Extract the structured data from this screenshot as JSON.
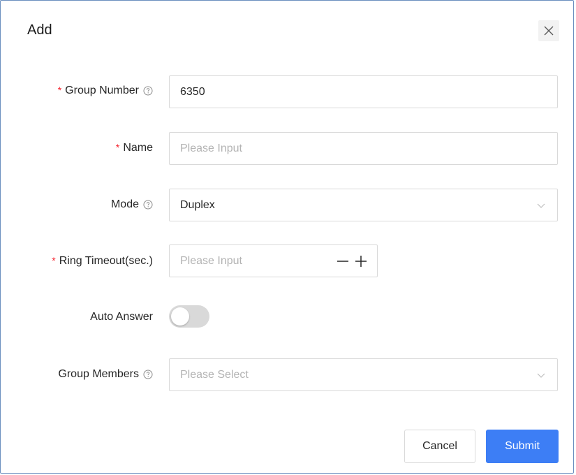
{
  "dialog": {
    "title": "Add",
    "close_icon": "close-icon"
  },
  "form": {
    "group_number": {
      "label": "Group Number",
      "required": true,
      "value": "6350",
      "help_icon": "question-circle-icon"
    },
    "name": {
      "label": "Name",
      "required": true,
      "placeholder": "Please Input"
    },
    "mode": {
      "label": "Mode",
      "selected": "Duplex",
      "help_icon": "question-circle-icon"
    },
    "ring_timeout": {
      "label": "Ring Timeout(sec.)",
      "required": true,
      "placeholder": "Please Input",
      "minus_icon": "minus-icon",
      "plus_icon": "plus-icon"
    },
    "auto_answer": {
      "label": "Auto Answer",
      "enabled": false
    },
    "group_members": {
      "label": "Group Members",
      "placeholder": "Please Select",
      "help_icon": "question-circle-icon"
    }
  },
  "buttons": {
    "cancel": "Cancel",
    "submit": "Submit"
  },
  "colors": {
    "required": "#f5222d",
    "primary": "#3d7ef5",
    "border": "#d9d9d9",
    "placeholder": "#b3b3b3"
  }
}
